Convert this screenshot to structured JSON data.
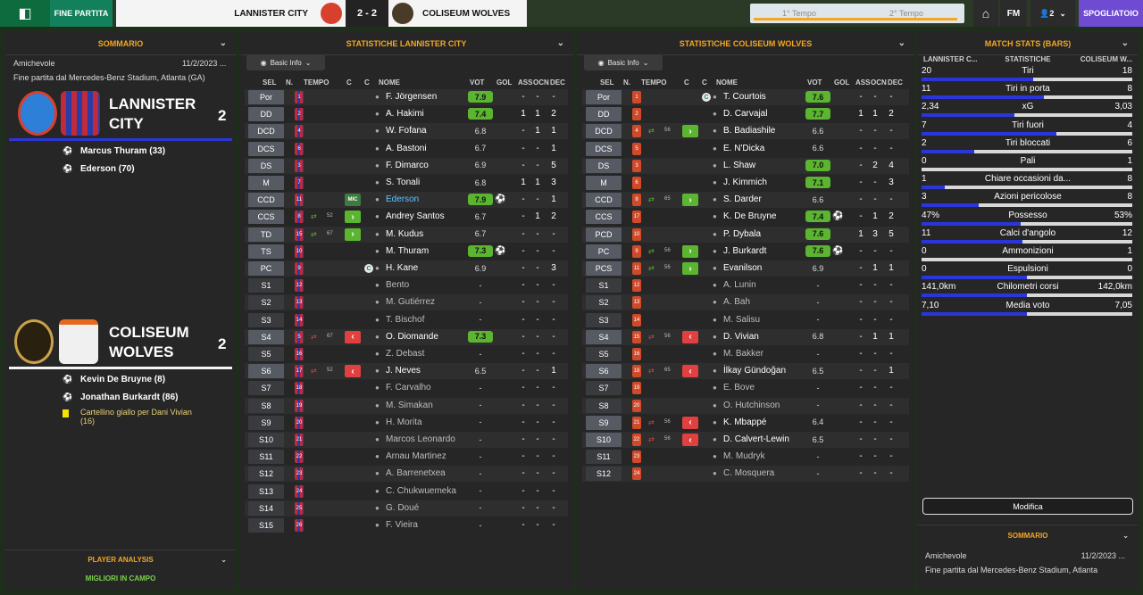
{
  "topbar": {
    "phase": "FINE PARTITA",
    "home": "LANNISTER CITY",
    "away": "COLISEUM WOLVES",
    "score": "2 - 2",
    "t1": "1° Tempo",
    "t2": "2° Tempo",
    "fm": "FM",
    "users": "2",
    "spogliatoio": "SPOGLIATOIO"
  },
  "left": {
    "header": "SOMMARIO",
    "competition": "Amichevole",
    "date": "11/2/2023 ...",
    "venue": "Fine partita dal Mercedes-Benz Stadium, Atlanta (GA)",
    "home": {
      "name1": "LANNISTER",
      "name2": "CITY",
      "score": "2",
      "events": [
        "Marcus Thuram (33)",
        "Ederson (70)"
      ]
    },
    "away": {
      "name1": "COLISEUM",
      "name2": "WOLVES",
      "score": "2",
      "events": [
        "Kevin De Bruyne (8)",
        "Jonathan Burkardt (86)"
      ],
      "card_line1": "Cartellino giallo per Dani Vivian",
      "card_line2": "(16)"
    },
    "analysis": "PLAYER ANALYSIS",
    "migliori": "MIGLIORI IN CAMPO",
    "basic_info": "Basic Info"
  },
  "cols": {
    "sel": "SEL",
    "n": "N.",
    "tempo": "TEMPO",
    "c": "C",
    "c2": "C",
    "nome": "NOME",
    "vot": "VOT",
    "gol": "GOL",
    "ass": "ASS",
    "ocn": "OCN",
    "dec": "DEC"
  },
  "home_stats": {
    "header": "STATISTICHE LANNISTER CITY",
    "basic": "Basic Info",
    "players": [
      {
        "pos": "Por",
        "num": "1",
        "name": "F. Jörgensen",
        "vot": "7.9",
        "g": true,
        "gol": "",
        "ass": "-",
        "ocn": "-",
        "dec": "-"
      },
      {
        "pos": "DD",
        "num": "2",
        "name": "A. Hakimi",
        "vot": "7.4",
        "g": true,
        "gol": "",
        "ass": "1",
        "ocn": "1",
        "dec": "2"
      },
      {
        "pos": "DCD",
        "num": "4",
        "name": "W. Fofana",
        "vot": "6.8",
        "gol": "",
        "ass": "-",
        "ocn": "1",
        "dec": "1"
      },
      {
        "pos": "DCS",
        "num": "6",
        "name": "A. Bastoni",
        "vot": "6.7",
        "gol": "",
        "ass": "-",
        "ocn": "-",
        "dec": "1"
      },
      {
        "pos": "DS",
        "num": "3",
        "name": "F. Dimarco",
        "vot": "6.9",
        "gol": "",
        "ass": "-",
        "ocn": "-",
        "dec": "5"
      },
      {
        "pos": "M",
        "num": "7",
        "name": "S. Tonali",
        "vot": "6.8",
        "gol": "",
        "ass": "1",
        "ocn": "1",
        "dec": "3"
      },
      {
        "pos": "CCD",
        "num": "11",
        "name": "Ederson",
        "vot": "7.9",
        "g": true,
        "gol": "⚽",
        "ass": "-",
        "ocn": "-",
        "dec": "1",
        "mic": "MIC",
        "hl": true
      },
      {
        "pos": "CCS",
        "num": "8",
        "name": "Andrey Santos",
        "vot": "6.7",
        "gol": "",
        "ass": "-",
        "ocn": "1",
        "dec": "2",
        "subin": "52"
      },
      {
        "pos": "TD",
        "num": "15",
        "name": "M. Kudus",
        "vot": "6.7",
        "gol": "",
        "ass": "-",
        "ocn": "-",
        "dec": "-",
        "subin": "67"
      },
      {
        "pos": "TS",
        "num": "10",
        "name": "M. Thuram",
        "vot": "7.3",
        "g": true,
        "gol": "⚽",
        "ass": "-",
        "ocn": "-",
        "dec": "-"
      },
      {
        "pos": "PC",
        "num": "9",
        "name": "H. Kane",
        "vot": "6.9",
        "gol": "",
        "ass": "-",
        "ocn": "-",
        "dec": "3",
        "cap": "C"
      },
      {
        "pos": "S1",
        "num": "12",
        "name": "Bento",
        "vot": "-",
        "gol": "",
        "ass": "-",
        "ocn": "-",
        "dec": "-",
        "sub": true
      },
      {
        "pos": "S2",
        "num": "13",
        "name": "M. Gutiérrez",
        "vot": "-",
        "gol": "",
        "ass": "-",
        "ocn": "-",
        "dec": "-",
        "sub": true
      },
      {
        "pos": "S3",
        "num": "14",
        "name": "T. Bischof",
        "vot": "-",
        "gol": "",
        "ass": "-",
        "ocn": "-",
        "dec": "-",
        "sub": true
      },
      {
        "pos": "S4",
        "num": "5",
        "name": "O. Diomande",
        "vot": "7.3",
        "g": true,
        "gol": "",
        "ass": "-",
        "ocn": "-",
        "dec": "-",
        "subout": "67"
      },
      {
        "pos": "S5",
        "num": "16",
        "name": "Z. Debast",
        "vot": "-",
        "gol": "",
        "ass": "-",
        "ocn": "-",
        "dec": "-",
        "sub": true
      },
      {
        "pos": "S6",
        "num": "17",
        "name": "J. Neves",
        "vot": "6.5",
        "gol": "",
        "ass": "-",
        "ocn": "-",
        "dec": "1",
        "subout": "52"
      },
      {
        "pos": "S7",
        "num": "18",
        "name": "F. Carvalho",
        "vot": "-",
        "gol": "",
        "ass": "-",
        "ocn": "-",
        "dec": "-",
        "sub": true
      },
      {
        "pos": "S8",
        "num": "19",
        "name": "M. Simakan",
        "vot": "-",
        "gol": "",
        "ass": "-",
        "ocn": "-",
        "dec": "-",
        "sub": true
      },
      {
        "pos": "S9",
        "num": "20",
        "name": "H. Morita",
        "vot": "-",
        "gol": "",
        "ass": "-",
        "ocn": "-",
        "dec": "-",
        "sub": true
      },
      {
        "pos": "S10",
        "num": "21",
        "name": "Marcos Leonardo",
        "vot": "-",
        "gol": "",
        "ass": "-",
        "ocn": "-",
        "dec": "-",
        "sub": true
      },
      {
        "pos": "S11",
        "num": "22",
        "name": "Arnau Martinez",
        "vot": "-",
        "gol": "",
        "ass": "-",
        "ocn": "-",
        "dec": "-",
        "sub": true
      },
      {
        "pos": "S12",
        "num": "23",
        "name": "A. Barrenetxea",
        "vot": "-",
        "gol": "",
        "ass": "-",
        "ocn": "-",
        "dec": "-",
        "sub": true
      },
      {
        "pos": "S13",
        "num": "24",
        "name": "C. Chukwuemeka",
        "vot": "-",
        "gol": "",
        "ass": "-",
        "ocn": "-",
        "dec": "-",
        "sub": true
      },
      {
        "pos": "S14",
        "num": "25",
        "name": "G. Doué",
        "vot": "-",
        "gol": "",
        "ass": "-",
        "ocn": "-",
        "dec": "-",
        "sub": true
      },
      {
        "pos": "S15",
        "num": "26",
        "name": "F. Vieira",
        "vot": "-",
        "gol": "",
        "ass": "-",
        "ocn": "-",
        "dec": "-",
        "sub": true
      }
    ]
  },
  "away_stats": {
    "header": "STATISTICHE COLISEUM WOLVES",
    "basic": "Basic Info",
    "players": [
      {
        "pos": "Por",
        "num": "1",
        "name": "T. Courtois",
        "vot": "7.6",
        "g": true,
        "gol": "",
        "ass": "-",
        "ocn": "-",
        "dec": "-",
        "cap": "C"
      },
      {
        "pos": "DD",
        "num": "2",
        "name": "D. Carvajal",
        "vot": "7.7",
        "g": true,
        "gol": "",
        "ass": "1",
        "ocn": "1",
        "dec": "2"
      },
      {
        "pos": "DCD",
        "num": "4",
        "name": "B. Badiashile",
        "vot": "6.6",
        "gol": "",
        "ass": "-",
        "ocn": "-",
        "dec": "-",
        "subin": "56"
      },
      {
        "pos": "DCS",
        "num": "5",
        "name": "E. N'Dicka",
        "vot": "6.6",
        "gol": "",
        "ass": "-",
        "ocn": "-",
        "dec": "-"
      },
      {
        "pos": "DS",
        "num": "3",
        "name": "L. Shaw",
        "vot": "7.0",
        "g": true,
        "gol": "",
        "ass": "-",
        "ocn": "2",
        "dec": "4"
      },
      {
        "pos": "M",
        "num": "6",
        "name": "J. Kimmich",
        "vot": "7.1",
        "g": true,
        "gol": "",
        "ass": "-",
        "ocn": "-",
        "dec": "3"
      },
      {
        "pos": "CCD",
        "num": "8",
        "name": "S. Darder",
        "vot": "6.6",
        "gol": "",
        "ass": "-",
        "ocn": "-",
        "dec": "-",
        "subin": "65"
      },
      {
        "pos": "CCS",
        "num": "17",
        "name": "K. De Bruyne",
        "vot": "7.4",
        "g": true,
        "gol": "⚽",
        "ass": "-",
        "ocn": "1",
        "dec": "2"
      },
      {
        "pos": "PCD",
        "num": "10",
        "name": "P. Dybala",
        "vot": "7.6",
        "g": true,
        "gol": "",
        "ass": "1",
        "ocn": "3",
        "dec": "5"
      },
      {
        "pos": "PC",
        "num": "9",
        "name": "J. Burkardt",
        "vot": "7.6",
        "g": true,
        "gol": "⚽",
        "ass": "-",
        "ocn": "-",
        "dec": "-",
        "subin": "56"
      },
      {
        "pos": "PCS",
        "num": "11",
        "name": "Evanilson",
        "vot": "6.9",
        "gol": "",
        "ass": "-",
        "ocn": "1",
        "dec": "1",
        "subin": "56"
      },
      {
        "pos": "S1",
        "num": "12",
        "name": "A. Lunin",
        "vot": "-",
        "gol": "",
        "ass": "-",
        "ocn": "-",
        "dec": "-",
        "sub": true
      },
      {
        "pos": "S2",
        "num": "13",
        "name": "A. Bah",
        "vot": "-",
        "gol": "",
        "ass": "-",
        "ocn": "-",
        "dec": "-",
        "sub": true
      },
      {
        "pos": "S3",
        "num": "14",
        "name": "M. Salisu",
        "vot": "-",
        "gol": "",
        "ass": "-",
        "ocn": "-",
        "dec": "-",
        "sub": true
      },
      {
        "pos": "S4",
        "num": "15",
        "name": "D. Vivian",
        "vot": "6.8",
        "gol": "",
        "ass": "-",
        "ocn": "1",
        "dec": "1",
        "subout": "56"
      },
      {
        "pos": "S5",
        "num": "16",
        "name": "M. Bakker",
        "vot": "-",
        "gol": "",
        "ass": "-",
        "ocn": "-",
        "dec": "-",
        "sub": true
      },
      {
        "pos": "S6",
        "num": "18",
        "name": "İlkay Gündoğan",
        "vot": "6.5",
        "gol": "",
        "ass": "-",
        "ocn": "-",
        "dec": "1",
        "subout": "65"
      },
      {
        "pos": "S7",
        "num": "19",
        "name": "E. Bove",
        "vot": "-",
        "gol": "",
        "ass": "-",
        "ocn": "-",
        "dec": "-",
        "sub": true
      },
      {
        "pos": "S8",
        "num": "20",
        "name": "O. Hutchinson",
        "vot": "-",
        "gol": "",
        "ass": "-",
        "ocn": "-",
        "dec": "-",
        "sub": true
      },
      {
        "pos": "S9",
        "num": "21",
        "name": "K. Mbappé",
        "vot": "6.4",
        "gol": "",
        "ass": "-",
        "ocn": "-",
        "dec": "-",
        "subout": "56"
      },
      {
        "pos": "S10",
        "num": "22",
        "name": "D. Calvert-Lewin",
        "vot": "6.5",
        "gol": "",
        "ass": "-",
        "ocn": "-",
        "dec": "-",
        "subout": "56"
      },
      {
        "pos": "S11",
        "num": "23",
        "name": "M. Mudryk",
        "vot": "-",
        "gol": "",
        "ass": "-",
        "ocn": "-",
        "dec": "-",
        "sub": true
      },
      {
        "pos": "S12",
        "num": "24",
        "name": "C. Mosquera",
        "vot": "-",
        "gol": "",
        "ass": "-",
        "ocn": "-",
        "dec": "-",
        "sub": true
      }
    ]
  },
  "match_stats": {
    "header": "MATCH STATS (BARS)",
    "col_home": "LANNISTER C...",
    "col_mid": "STATISTICHE",
    "col_away": "COLISEUM W...",
    "modifica": "Modifica",
    "summary_header": "SOMMARIO",
    "competition": "Amichevole",
    "date": "11/2/2023 ...",
    "venue": "Fine partita dal Mercedes-Benz Stadium, Atlanta",
    "rows": [
      {
        "l": "20",
        "c": "Tiri",
        "r": "18",
        "f": 0.53
      },
      {
        "l": "11",
        "c": "Tiri in porta",
        "r": "8",
        "f": 0.58
      },
      {
        "l": "2,34",
        "c": "xG",
        "r": "3,03",
        "f": 0.44
      },
      {
        "l": "7",
        "c": "Tiri fuori",
        "r": "4",
        "f": 0.64
      },
      {
        "l": "2",
        "c": "Tiri bloccati",
        "r": "6",
        "f": 0.25
      },
      {
        "l": "0",
        "c": "Pali",
        "r": "1",
        "f": 0.0
      },
      {
        "l": "1",
        "c": "Chiare occasioni da...",
        "r": "8",
        "f": 0.11
      },
      {
        "l": "3",
        "c": "Azioni pericolose",
        "r": "8",
        "f": 0.27
      },
      {
        "l": "47%",
        "c": "Possesso",
        "r": "53%",
        "f": 0.47
      },
      {
        "l": "11",
        "c": "Calci d'angolo",
        "r": "12",
        "f": 0.48
      },
      {
        "l": "0",
        "c": "Ammonizioni",
        "r": "1",
        "f": 0.0
      },
      {
        "l": "0",
        "c": "Espulsioni",
        "r": "0",
        "f": 0.5
      },
      {
        "l": "141,0km",
        "c": "Chilometri corsi",
        "r": "142,0km",
        "f": 0.5
      },
      {
        "l": "7,10",
        "c": "Media voto",
        "r": "7,05",
        "f": 0.5
      }
    ]
  }
}
